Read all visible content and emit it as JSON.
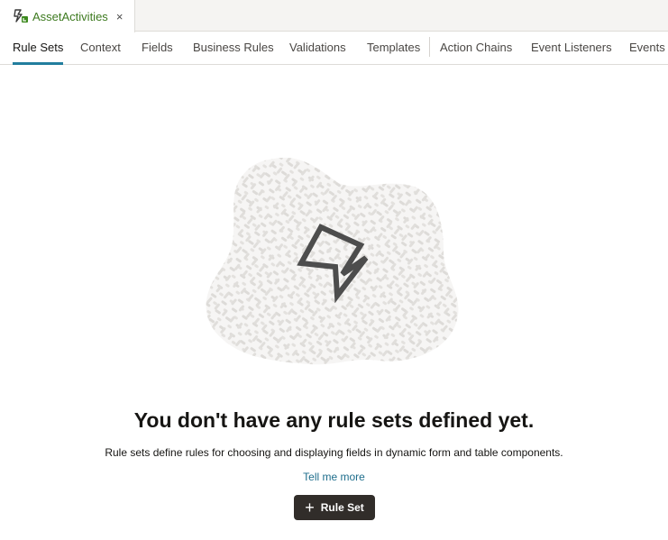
{
  "file_tab": {
    "title": "AssetActivities",
    "icon": "rule-set-icon",
    "close": "×"
  },
  "nav_tabs": [
    {
      "label": "Rule Sets",
      "active": true
    },
    {
      "label": "Context",
      "active": false
    },
    {
      "label": "Fields",
      "active": false
    },
    {
      "label": "Business Rules",
      "active": false
    },
    {
      "label": "Validations",
      "active": false
    },
    {
      "label": "Templates",
      "active": false
    },
    {
      "label": "Action Chains",
      "active": false
    },
    {
      "label": "Event Listeners",
      "active": false
    },
    {
      "label": "Events",
      "active": false
    }
  ],
  "empty_state": {
    "illustration_icon": "lightning-icon",
    "headline": "You don't have any rule sets defined yet.",
    "description": "Rule sets define rules for choosing and displaying fields in dynamic form and table components.",
    "link_label": "Tell me more",
    "button_icon": "plus-icon",
    "button_label": "Rule Set"
  },
  "colors": {
    "active_tab_underline": "#227e9e",
    "file_tab_title": "#3d7a1f",
    "link": "#1f6e8c",
    "button_bg": "#312d2a"
  }
}
